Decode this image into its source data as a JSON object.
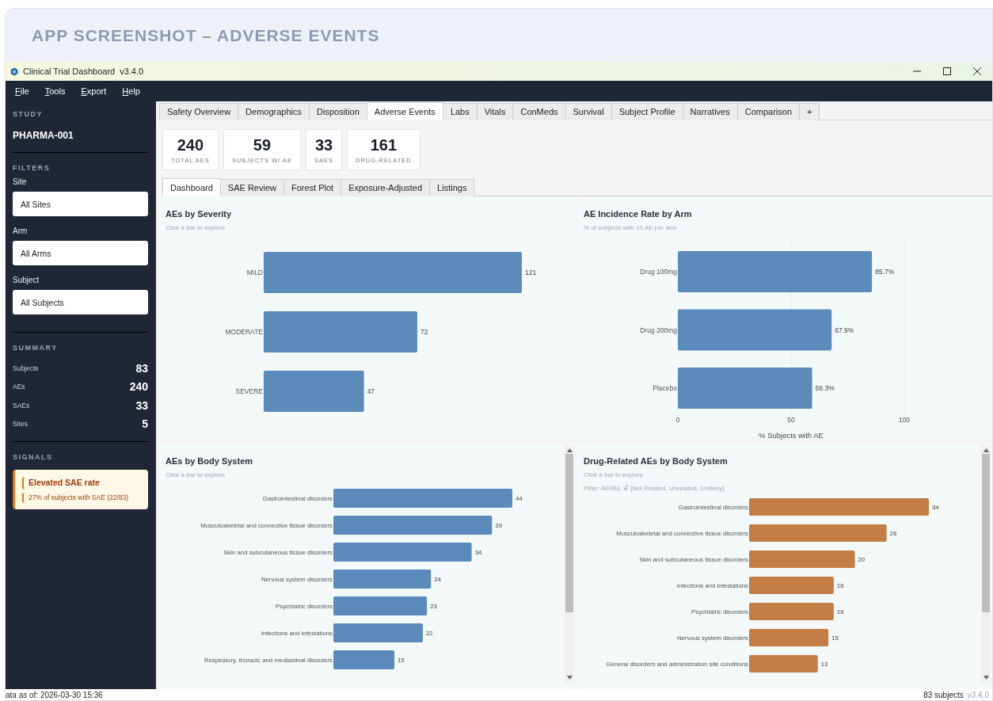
{
  "header": {
    "title": "APP SCREENSHOT – ADVERSE EVENTS"
  },
  "window": {
    "title": "Clinical Trial Dashboard",
    "version": "v3.4.0"
  },
  "menu": [
    "File",
    "Tools",
    "Export",
    "Help"
  ],
  "sidebar": {
    "study_heading": "STUDY",
    "study": "PHARMA-001",
    "filters_heading": "FILTERS",
    "filters": [
      {
        "label": "Site",
        "value": "All Sites"
      },
      {
        "label": "Arm",
        "value": "All Arms"
      },
      {
        "label": "Subject",
        "value": "All Subjects"
      }
    ],
    "summary_heading": "SUMMARY",
    "summary": [
      {
        "label": "Subjects",
        "value": "83"
      },
      {
        "label": "AEs",
        "value": "240"
      },
      {
        "label": "SAEs",
        "value": "33"
      },
      {
        "label": "Sites",
        "value": "5"
      }
    ],
    "signals_heading": "SIGNALS",
    "signals": [
      {
        "title": "Elevated SAE rate",
        "detail": "27% of subjects with SAE (22/83)"
      }
    ]
  },
  "tabs": [
    {
      "label": "Safety Overview",
      "selected": false
    },
    {
      "label": "Demographics",
      "selected": false
    },
    {
      "label": "Disposition",
      "selected": false
    },
    {
      "label": "Adverse Events",
      "selected": true
    },
    {
      "label": "Labs",
      "selected": false
    },
    {
      "label": "Vitals",
      "selected": false
    },
    {
      "label": "ConMeds",
      "selected": false
    },
    {
      "label": "Survival",
      "selected": false
    },
    {
      "label": "Subject Profile",
      "selected": false
    },
    {
      "label": "Narratives",
      "selected": false
    },
    {
      "label": "Comparison",
      "selected": false
    },
    {
      "label": "+",
      "selected": false
    }
  ],
  "kpis": [
    {
      "value": "240",
      "label": "TOTAL AES"
    },
    {
      "value": "59",
      "label": "SUBJECTS W/ AE"
    },
    {
      "value": "33",
      "label": "SAES"
    },
    {
      "value": "161",
      "label": "DRUG-RELATED"
    }
  ],
  "subtabs": [
    {
      "label": "Dashboard",
      "selected": true
    },
    {
      "label": "SAE Review",
      "selected": false
    },
    {
      "label": "Forest Plot",
      "selected": false
    },
    {
      "label": "Exposure-Adjusted",
      "selected": false
    },
    {
      "label": "Listings",
      "selected": false
    }
  ],
  "panels": [
    {
      "title": "AEs by Severity",
      "subtitle": "Click a bar to explore",
      "chart_data": {
        "type": "bar",
        "orientation": "horizontal",
        "categories": [
          "MILD",
          "MODERATE",
          "SEVERE"
        ],
        "series": [
          {
            "color": "#5a8bba",
            "values": [
              121,
              72,
              47
            ]
          }
        ],
        "data_labels": true
      }
    },
    {
      "title": "AE Incidence Rate by Arm",
      "subtitle": "% of subjects with ≥1 AE per arm",
      "chart_data": {
        "type": "bar",
        "orientation": "horizontal",
        "xlabel": "% Subjects with AE",
        "categories": [
          "Drug 100mg",
          "Drug 200mg",
          "Placebo"
        ],
        "series": [
          {
            "color": "#5a8bba",
            "values": [
              85.7,
              67.9,
              59.3
            ]
          }
        ],
        "xlim": [
          0,
          100
        ],
        "xticks": [
          0,
          50,
          100
        ],
        "value_labels": [
          "85.7%",
          "67.9%",
          "59.3%"
        ]
      }
    },
    {
      "title": "AEs by Body System",
      "subtitle": "Click a bar to explore",
      "chart_data": {
        "type": "bar",
        "orientation": "horizontal",
        "categories": [
          "Gastrointestinal disorders",
          "Musculoskeletal and connective tissue disorders",
          "Skin and subcutaneous tissue disorders",
          "Nervous system disorders",
          "Psychiatric disorders",
          "Infections and infestations",
          "Respiratory, thoracic and mediastinal disorders"
        ],
        "series": [
          {
            "color": "#5a8bba",
            "values": [
              44,
              39,
              34,
              24,
              23,
              22,
              15
            ]
          }
        ],
        "data_labels": true
      }
    },
    {
      "title": "Drug-Related AEs by Body System",
      "subtitle": "Click a bar to explore",
      "filter": "Filter: AEREL ∉ [Not Related, Unrelated, Unlikely]",
      "chart_data": {
        "type": "bar",
        "orientation": "horizontal",
        "categories": [
          "Gastrointestinal disorders",
          "Musculoskeletal and connective tissue disorders",
          "Skin and subcutaneous tissue disorders",
          "Infections and infestations",
          "Psychiatric disorders",
          "Nervous system disorders",
          "General disorders and administration site conditions"
        ],
        "series": [
          {
            "color": "#c47d45",
            "values": [
              34,
              26,
              20,
              16,
              16,
              15,
              13
            ]
          }
        ],
        "data_labels": true
      }
    }
  ],
  "status_bar": {
    "left": "ata as of: 2026-03-30 15:36",
    "count": "83 subjects",
    "version": "v3.4.0"
  }
}
